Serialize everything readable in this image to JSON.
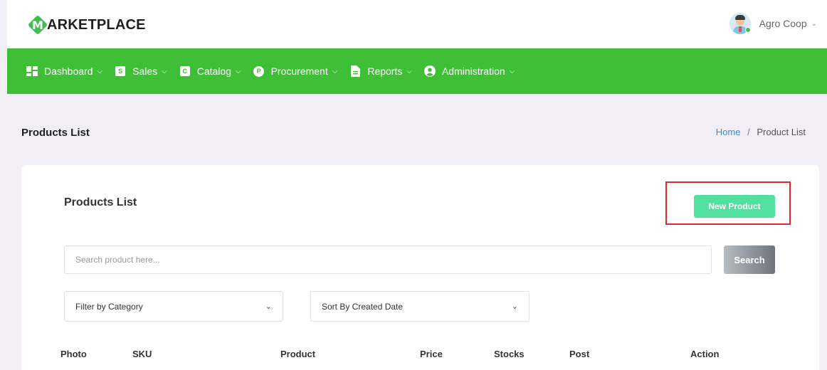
{
  "brand": {
    "name": "ARKETPLACE",
    "mark_letter": "M",
    "accent": "#3fbf36"
  },
  "user": {
    "name": "Agro Coop",
    "avatar_icon": "user-avatar-icon"
  },
  "nav": {
    "items": [
      {
        "label": "Dashboard",
        "icon": "dashboard-icon"
      },
      {
        "label": "Sales",
        "icon": "sales-icon",
        "glyph": "S"
      },
      {
        "label": "Catalog",
        "icon": "catalog-icon",
        "glyph": "C"
      },
      {
        "label": "Procurement",
        "icon": "procurement-icon",
        "glyph": "P"
      },
      {
        "label": "Reports",
        "icon": "reports-icon"
      },
      {
        "label": "Administration",
        "icon": "administration-icon"
      }
    ]
  },
  "page": {
    "title": "Products List",
    "breadcrumb": {
      "home": "Home",
      "separator": "/",
      "current": "Product List"
    }
  },
  "card": {
    "title": "Products List",
    "new_button": "New Product",
    "search": {
      "placeholder": "Search product here...",
      "value": "",
      "button": "Search"
    },
    "filter_category": "Filter by Category",
    "sort": "Sort By Created Date",
    "columns": [
      "Photo",
      "SKU",
      "Product",
      "Price",
      "Stocks",
      "Post",
      "Action"
    ]
  },
  "colors": {
    "nav_green": "#3fbf36",
    "new_button": "#52e0a0",
    "highlight_border": "#e0262f",
    "breadcrumb_link": "#2f8fe8"
  }
}
